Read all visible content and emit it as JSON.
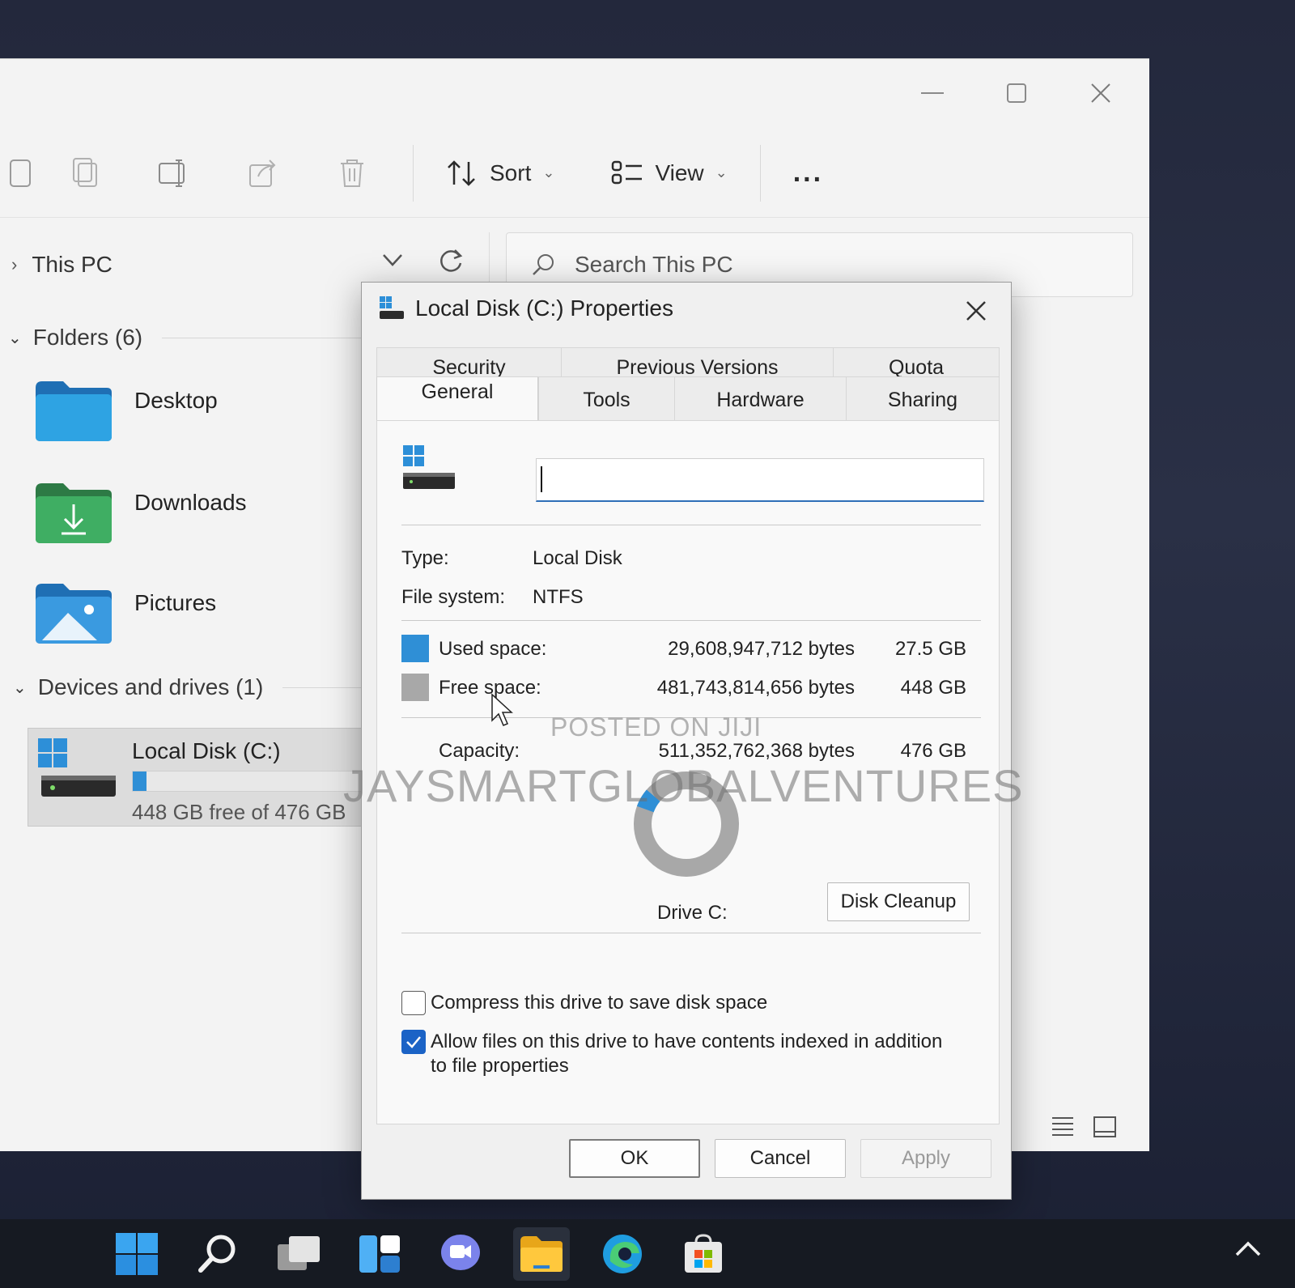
{
  "explorer": {
    "toolbar": {
      "sort_label": "Sort",
      "view_label": "View",
      "more_label": "..."
    },
    "address": {
      "path": "This PC",
      "search_placeholder": "Search This PC"
    },
    "folders_header": "Folders (6)",
    "folders": [
      {
        "label": "Desktop"
      },
      {
        "label": "Downloads"
      },
      {
        "label": "Pictures"
      }
    ],
    "devices_header": "Devices and drives (1)",
    "drive": {
      "label": "Local Disk (C:)",
      "free_text": "448 GB free of 476 GB",
      "used_fraction": 0.058
    }
  },
  "dialog": {
    "title": "Local Disk (C:) Properties",
    "tabs_top": [
      "Security",
      "Previous Versions",
      "Quota"
    ],
    "tabs_bottom": [
      "General",
      "Tools",
      "Hardware",
      "Sharing"
    ],
    "active_tab": "General",
    "name_value": "",
    "type_label": "Type:",
    "type_value": "Local Disk",
    "fs_label": "File system:",
    "fs_value": "NTFS",
    "used_label": "Used space:",
    "used_bytes": "29,608,947,712 bytes",
    "used_gb": "27.5 GB",
    "free_label": "Free space:",
    "free_bytes": "481,743,814,656 bytes",
    "free_gb": "448 GB",
    "capacity_label": "Capacity:",
    "capacity_bytes": "511,352,762,368 bytes",
    "capacity_gb": "476 GB",
    "used_fraction": 0.058,
    "used_color": "#2f8fd6",
    "free_color": "#a8a8a8",
    "drive_label": "Drive C:",
    "cleanup_label": "Disk Cleanup",
    "compress_label": "Compress this drive to save disk space",
    "compress_checked": false,
    "index_label": "Allow files on this drive to have contents indexed in addition to file properties",
    "index_checked": true,
    "ok_label": "OK",
    "cancel_label": "Cancel",
    "apply_label": "Apply"
  },
  "watermark": {
    "line1": "POSTED ON JIJI",
    "line2": "JAYSMARTGLOBALVENTURES"
  }
}
